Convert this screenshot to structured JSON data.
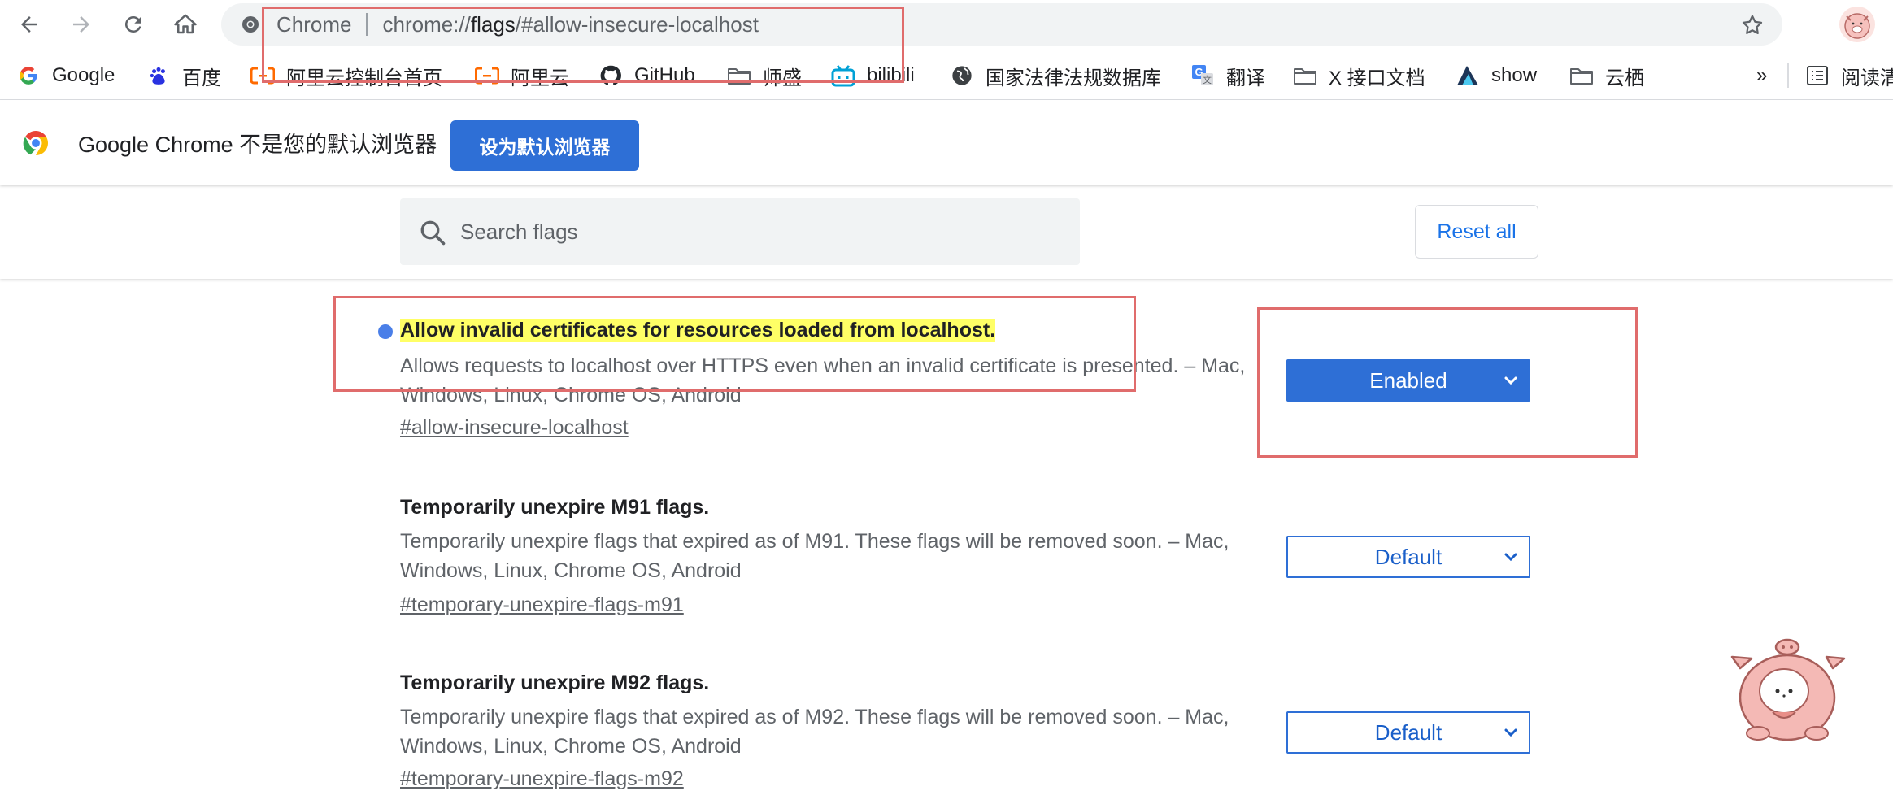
{
  "browser": {
    "omnibox": {
      "site_label": "Chrome",
      "url_scheme": "chrome://",
      "url_host": "flags",
      "url_path": "/#allow-insecure-localhost"
    }
  },
  "bookmarks": [
    {
      "label": "Google",
      "icon": "google-icon"
    },
    {
      "label": "百度",
      "icon": "baidu-icon"
    },
    {
      "label": "阿里云控制台首页",
      "icon": "aliyun-icon"
    },
    {
      "label": "阿里云",
      "icon": "aliyun-icon"
    },
    {
      "label": "GitHub",
      "icon": "github-icon"
    },
    {
      "label": "师盛",
      "icon": "folder-icon"
    },
    {
      "label": "bilibili",
      "icon": "bilibili-icon"
    },
    {
      "label": "国家法律法规数据库",
      "icon": "globe-icon"
    },
    {
      "label": "翻译",
      "icon": "translate-icon"
    },
    {
      "label": "X 接口文档",
      "icon": "folder-icon"
    },
    {
      "label": "show",
      "icon": "show-icon"
    },
    {
      "label": "云栖",
      "icon": "folder-icon"
    }
  ],
  "bookmarks_overflow": "»",
  "reading_list": "阅读清",
  "infobar": {
    "message": "Google Chrome 不是您的默认浏览器",
    "button": "设为默认浏览器"
  },
  "flags_header": {
    "search_placeholder": "Search flags",
    "reset_label": "Reset all"
  },
  "flags": [
    {
      "title": "Allow invalid certificates for resources loaded from localhost.",
      "description": "Allows requests to localhost over HTTPS even when an invalid certificate is presented. – Mac, Windows, Linux, Chrome OS, Android",
      "anchor": "#allow-insecure-localhost",
      "value": "Enabled",
      "highlighted": true
    },
    {
      "title": "Temporarily unexpire M91 flags.",
      "description": "Temporarily unexpire flags that expired as of M91. These flags will be removed soon. – Mac, Windows, Linux, Chrome OS, Android",
      "anchor": "#temporary-unexpire-flags-m91",
      "value": "Default"
    },
    {
      "title": "Temporarily unexpire M92 flags.",
      "description": "Temporarily unexpire flags that expired as of M92. These flags will be removed soon. – Mac, Windows, Linux, Chrome OS, Android",
      "anchor": "#temporary-unexpire-flags-m92",
      "value": "Default"
    }
  ],
  "colors": {
    "accent": "#2e6fd6",
    "annotation": "#e06c6c",
    "highlight": "#ffff66",
    "modified_dot": "#4a7fe8"
  }
}
